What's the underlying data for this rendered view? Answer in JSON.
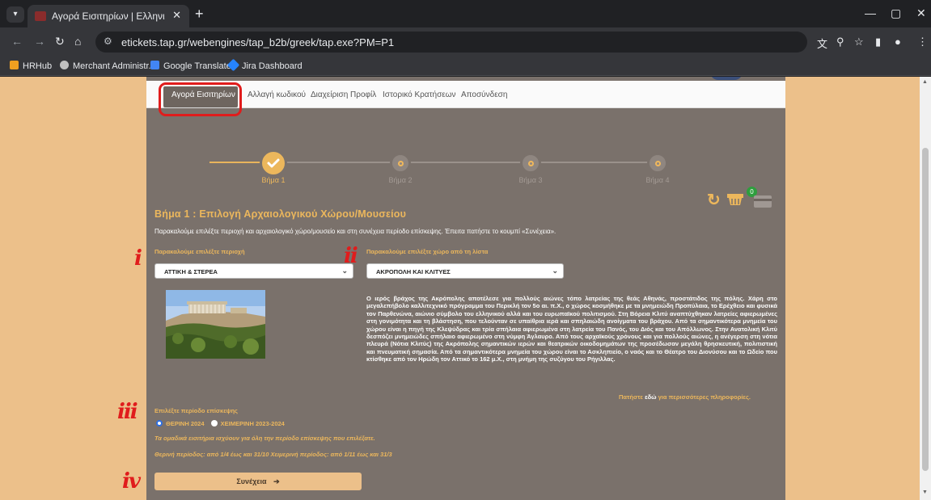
{
  "browser": {
    "tab_title": "Αγορά Εισιτηρίων | Ελληνικοί / ",
    "tab_close": "✕",
    "new_tab": "+",
    "url": "etickets.tap.gr/webengines/tap_b2b/greek/tap.exe?PM=P1",
    "bookmarks": [
      "HRHub",
      "Merchant Administr...",
      "Google Translate",
      "Jira Dashboard"
    ],
    "bookmark_colors": [
      "#f0a020",
      "#c0c0c0",
      "#4285f4",
      "#2684ff"
    ]
  },
  "menu": {
    "items": [
      "Αγορά Εισιτηρίων",
      "Αλλαγή κωδικού",
      "Διαχείριση Προφίλ",
      "Ιστορικό Κρατήσεων",
      "Αποσύνδεση"
    ],
    "active_index": 0
  },
  "steps": [
    {
      "label": "Βήμα 1",
      "done": true
    },
    {
      "label": "Βήμα 2",
      "done": false
    },
    {
      "label": "Βήμα 3",
      "done": false
    },
    {
      "label": "Βήμα 4",
      "done": false
    }
  ],
  "cart_count": "0",
  "step1": {
    "title": "Βήμα 1 : Επιλογή Αρχαιολογικού Χώρου/Μουσείου",
    "intro": "Παρακαλούμε επιλέξτε περιοχή και αρχαιολογικό χώρο/μουσείο και στη συνέχεια περίοδο επίσκεψης. Έπειτα πατήστε το κουμπί «Συνέχεια».",
    "region_label": "Παρακαλούμε επιλέξτε περιοχή",
    "region_value": "ΑΤΤΙΚΗ & ΣΤΕΡΕΑ",
    "site_label": "Παρακαλούμε επιλέξτε χώρο από τη λίστα",
    "site_value": "ΑΚΡΟΠΟΛΗ ΚΑΙ ΚΛΙΤΥΕΣ",
    "description": "Ο ιερός βράχος της Ακρόπολης αποτέλεσε για πολλούς αιώνες τόπο λατρείας της θεάς Αθηνάς, προστάτιδος της πόλης. Χάρη στο μεγαλεπήβολο καλλιτεχνικό πρόγραμμα του Περικλή τον 5ο αι. π.Χ., ο χώρος κοσμήθηκε με τα μνημειώδη Προπύλαια, το Ερέχθειο και φυσικά τον Παρθενώνα, αιώνιο σύμβολο του ελληνικού αλλά και του ευρωπαϊκού πολιτισμού. Στη Βόρεια Κλιτύ αναπτύχθηκαν λατρείες αφιερωμένες στη γονιμότητα και τη βλάστηση, που τελούνταν σε υπαίθρια ιερά και σπηλαιώδη ανοίγματα του βράχου. Από τα σημαντικότερα μνημεία του χώρου είναι η πηγή της Κλεψύδρας και τρία σπήλαια αφιερωμένα στη λατρεία του Πανός, του Διός και του Απόλλωνος. Στην Ανατολική Κλιτύ δεσπόζει μνημειώδες σπήλαιο αφιερωμένο στη νύμφη Άγλαυρο. Από τους αρχαϊκούς χρόνους και για πολλούς αιώνες, η ανέγερση στη νότια πλευρά (Νότια Κλιτύς) της Ακρόπολης σημαντικών ιερών και θεατρικών οικοδομημάτων της προσέδωσαν μεγάλη θρησκευτική, πολιτιστική και πνευματική σημασία. Από τα σημαντικότερα μνημεία του χώρου είναι το Ασκληπιείο, ο ναός και το Θέατρο του Διονύσου και το Ωδείο που κτίσθηκε από τον Ηρώδη τον Αττικό το 162 μ.Χ., στη μνήμη της συζύγου του Ρήγιλλας.",
    "more_prefix": "Πατήστε ",
    "more_link": "εδώ",
    "more_suffix": " για περισσότερες πληροφορίες.",
    "period_label": "Επιλέξτε περίοδο επίσκεψης",
    "period_options": [
      "ΘΕΡΙΝΗ 2024",
      "ΧΕΙΜΕΡΙΝΗ 2023-2024"
    ],
    "period_selected": 0,
    "group_note": "Τα ομαδικά εισιτήρια ισχύουν για όλη την περίοδο επίσκεψης που επιλέξατε.",
    "periods_note": "Θερινή περίοδος: από 1/4 έως και 31/10 Χειμερινή περίοδος: από 1/11 έως και 31/3",
    "continue_label": "Συνέχεια",
    "continue_arrow": "➔"
  },
  "annotations": [
    "i",
    "ii",
    "iii",
    "iv"
  ],
  "colors": {
    "accent": "#ecb75c",
    "panel": "#7a716b",
    "page_bg": "#ecc08a",
    "highlight": "#e01c1c"
  }
}
